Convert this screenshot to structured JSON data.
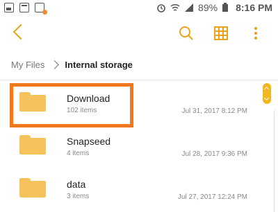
{
  "status_bar": {
    "battery": "89%",
    "time": "8:16 PM"
  },
  "toolbar": {
    "accent_color": "#e8a317"
  },
  "breadcrumb": {
    "items": [
      "My Files",
      "Internal storage"
    ]
  },
  "folders": [
    {
      "name": "Download",
      "count": "102 items",
      "date": "Jul 31, 2017 8:12 PM"
    },
    {
      "name": "Snapseed",
      "count": "4 items",
      "date": "Jul 28, 2017 9:36 PM"
    },
    {
      "name": "data",
      "count": "3 items",
      "date": "Jul 27, 2017 12:24 PM"
    }
  ],
  "highlight": {
    "color": "#f2781e",
    "target": "Download"
  }
}
